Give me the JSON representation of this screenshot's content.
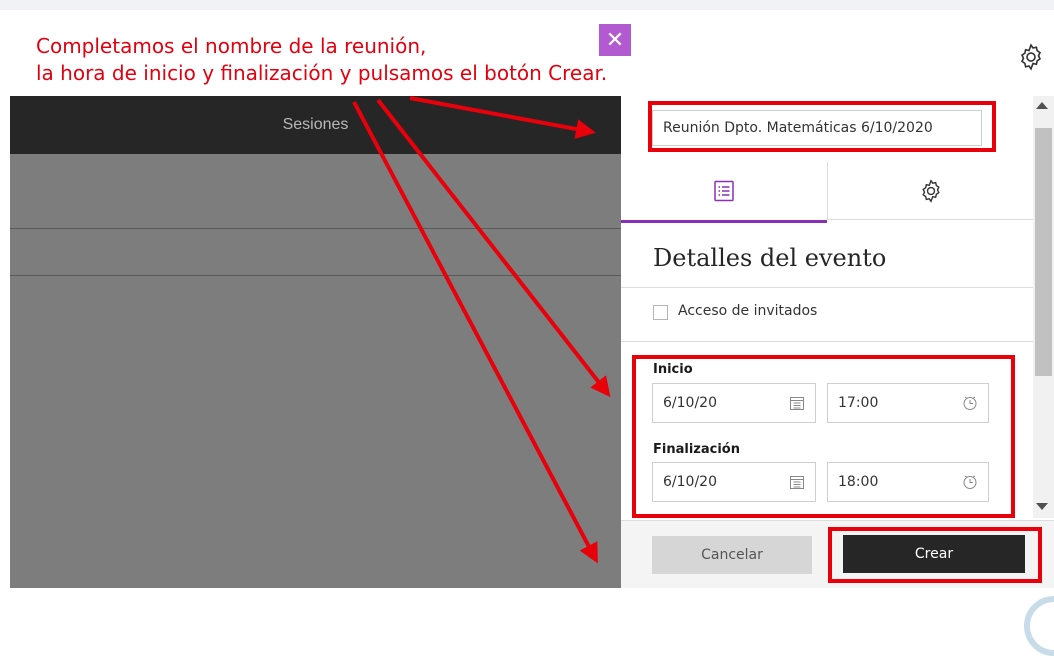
{
  "annotation": {
    "line1": "Completamos el nombre de la reunión,",
    "line2": "la hora de inicio y finalización y pulsamos el botón Crear."
  },
  "left_panel": {
    "header": "Sesiones"
  },
  "event": {
    "title_value": "Reunión Dpto. Matemáticas 6/10/2020",
    "tabs": [
      {
        "icon": "details-list-icon",
        "active": true
      },
      {
        "icon": "gear-icon",
        "active": false
      }
    ],
    "section_title": "Detalles del evento",
    "guest_access_label": "Acceso de invitados",
    "guest_access_checked": false,
    "start": {
      "label": "Inicio",
      "date": "6/10/20",
      "time": "17:00"
    },
    "end": {
      "label": "Finalización",
      "date": "6/10/20",
      "time": "18:00"
    }
  },
  "footer": {
    "cancel_label": "Cancelar",
    "create_label": "Crear"
  },
  "colors": {
    "accent": "#8a2fb8",
    "close_bg": "#b25bd1",
    "annotation_red": "#e3000f",
    "dark": "#262626"
  }
}
